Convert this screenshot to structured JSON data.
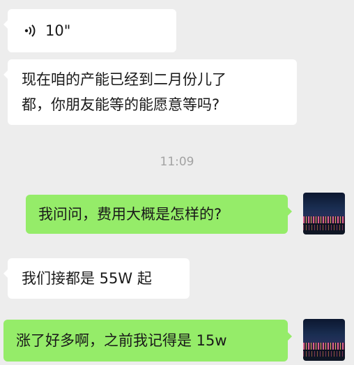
{
  "messages": [
    {
      "side": "left",
      "type": "voice",
      "duration": "10\""
    },
    {
      "side": "left",
      "type": "text",
      "lines": [
        "现在咱的产能已经到二月份儿了",
        "都，你朋友能等的能愿意等吗?"
      ]
    },
    {
      "side": "right",
      "type": "text",
      "text": "我问问，费用大概是怎样的?"
    },
    {
      "side": "left",
      "type": "text",
      "text": "我们接都是 55W 起"
    },
    {
      "side": "right",
      "type": "text",
      "text": "涨了好多啊，之前我记得是 15w"
    }
  ],
  "timestamp": "11:09",
  "colors": {
    "background": "#ededed",
    "left_bubble": "#ffffff",
    "right_bubble": "#95ec69",
    "timestamp": "#a3a3a3"
  },
  "icons": {
    "voice": "voice-wave-icon",
    "avatar": "night-city-avatar"
  }
}
